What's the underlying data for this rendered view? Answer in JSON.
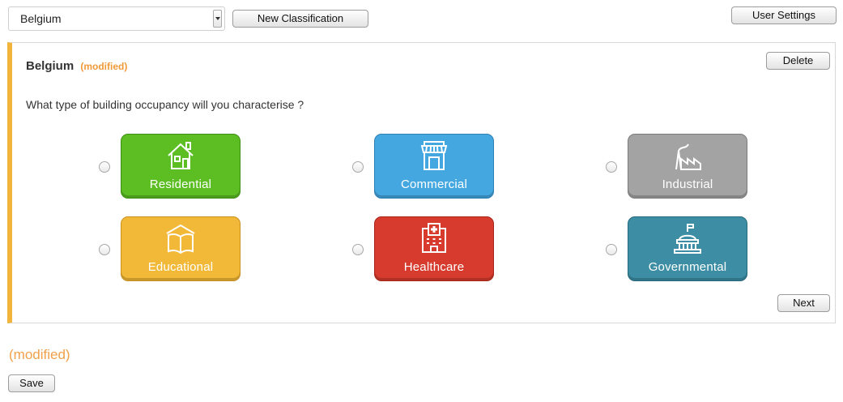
{
  "toolbar": {
    "country_select": "Belgium",
    "new_classification_label": "New Classification",
    "user_settings_label": "User Settings"
  },
  "panel": {
    "title": "Belgium",
    "modified_tag": "(modified)",
    "delete_label": "Delete",
    "question": "What type of building occupancy will you characterise ?",
    "next_label": "Next",
    "accent_color": "#f2b43a",
    "options": [
      {
        "label": "Residential",
        "icon": "house-icon",
        "color": "#5cbe23",
        "selected": false
      },
      {
        "label": "Commercial",
        "icon": "shop-icon",
        "color": "#45a7e0",
        "selected": false
      },
      {
        "label": "Industrial",
        "icon": "factory-icon",
        "color": "#a3a3a3",
        "selected": false
      },
      {
        "label": "Educational",
        "icon": "book-icon",
        "color": "#f2b938",
        "selected": false
      },
      {
        "label": "Healthcare",
        "icon": "hospital-icon",
        "color": "#d63b2d",
        "selected": false
      },
      {
        "label": "Governmental",
        "icon": "government-icon",
        "color": "#3d8ea5",
        "selected": false
      }
    ]
  },
  "footer": {
    "modified_text": "(modified)",
    "save_label": "Save"
  }
}
